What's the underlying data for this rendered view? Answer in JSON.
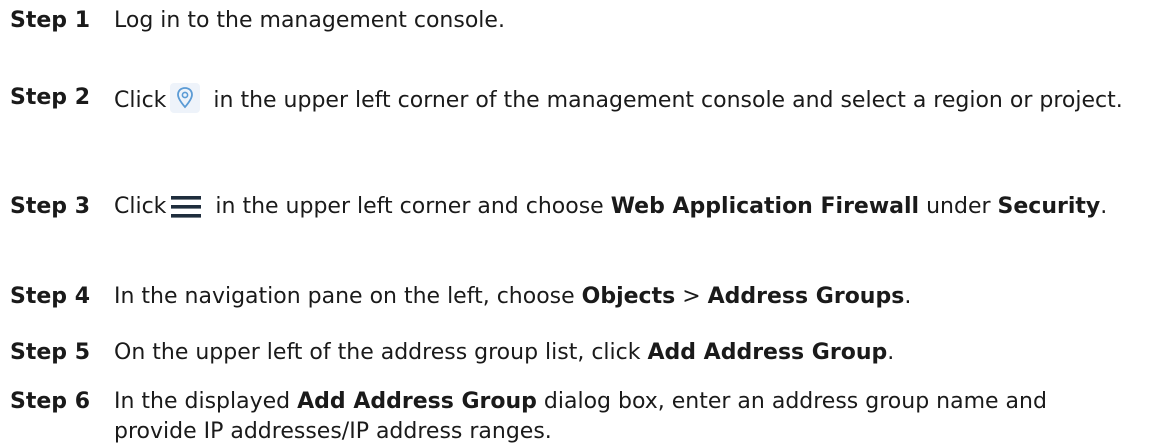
{
  "steps": [
    {
      "label": "Step 1",
      "parts": [
        "Log in to the management console."
      ]
    },
    {
      "label": "Step 2",
      "parts": [
        "Click",
        " in the upper left corner of the management console and select a region or project."
      ],
      "icon": "location-pin-icon"
    },
    {
      "label": "Step 3",
      "parts": [
        "Click",
        " in the upper left corner and choose ",
        "Web Application Firewall",
        " under ",
        "Security",
        "."
      ],
      "icon": "hamburger-menu-icon"
    },
    {
      "label": "Step 4",
      "parts": [
        "In the navigation pane on the left, choose ",
        "Objects",
        " > ",
        "Address Groups",
        "."
      ]
    },
    {
      "label": "Step 5",
      "parts": [
        "On the upper left of the address group list, click ",
        "Add Address Group",
        "."
      ]
    },
    {
      "label": "Step 6",
      "parts": [
        "In the displayed ",
        "Add Address Group",
        " dialog box, enter an address group name and provide IP addresses/IP address ranges."
      ]
    }
  ],
  "colors": {
    "text": "#1a1a1a",
    "pin_icon": "#5b9bd5",
    "menu_icon": "#1f2d3d"
  }
}
